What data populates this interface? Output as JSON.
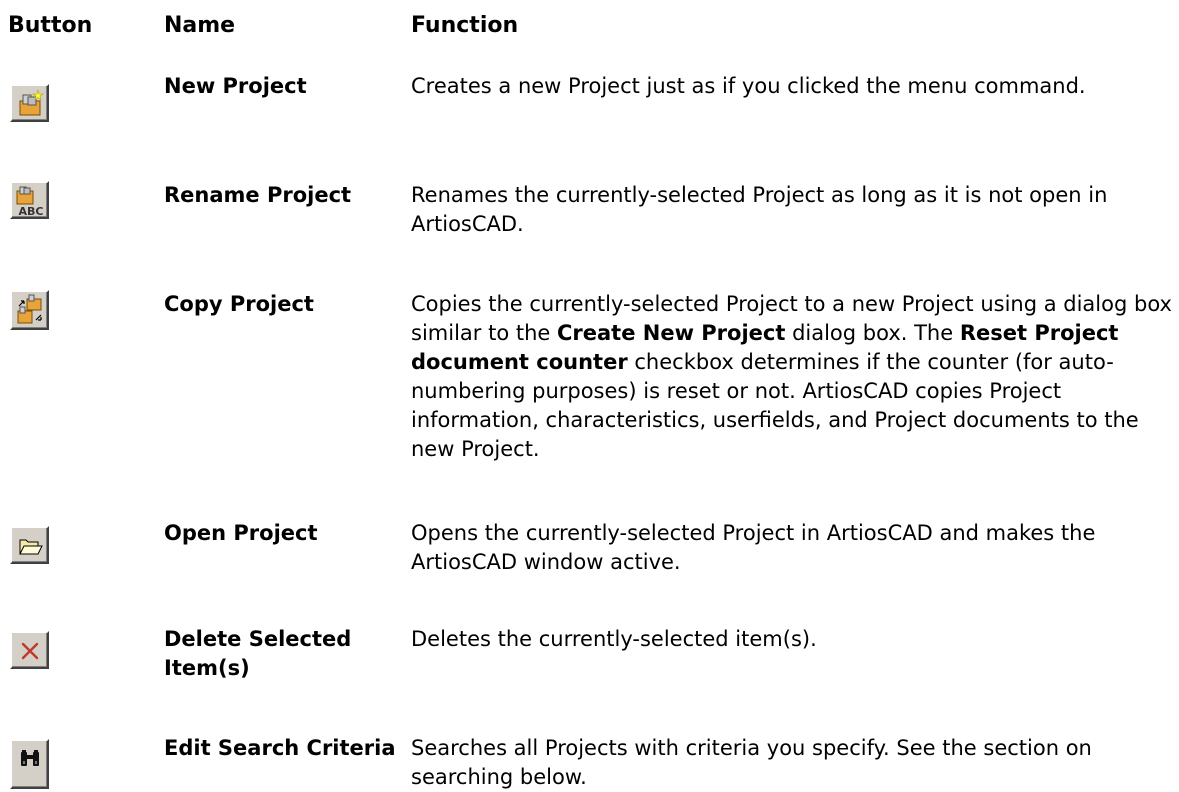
{
  "header": {
    "button": "Button",
    "name": "Name",
    "function": "Function"
  },
  "rows": [
    {
      "icon": "new-project-icon",
      "name": "New Project",
      "function": "Creates a new Project just as if you clicked the menu command."
    },
    {
      "icon": "rename-project-icon",
      "icon_text": "ABC",
      "name": "Rename Project",
      "function": "Renames the currently-selected Project as long as it is not open in ArtiosCAD."
    },
    {
      "icon": "copy-project-icon",
      "name": "Copy Project",
      "function_parts": {
        "p1": "Copies the currently-selected Project to a new Project using a dialog box similar to the ",
        "b1": "Create New Project",
        "p2": " dialog box. The ",
        "b2": "Reset Project document counter",
        "p3": " checkbox determines if the counter (for auto-numbering purposes) is reset or not. ArtiosCAD copies Project information, characteristics, userfields, and Project documents to the new Project."
      }
    },
    {
      "icon": "open-project-icon",
      "name": "Open Project",
      "function": "Opens the currently-selected Project in ArtiosCAD and makes the ArtiosCAD window active."
    },
    {
      "icon": "delete-icon",
      "name": "Delete Selected Item(s)",
      "function": "Deletes the currently-selected item(s)."
    },
    {
      "icon": "binoculars-icon",
      "name": "Edit Search Criteria",
      "function": "Searches all Projects with criteria you specify. See the section on searching below."
    }
  ],
  "colors": {
    "button_face": "#d4d0c8",
    "folder": "#e8a33a",
    "delete_x": "#c0392b"
  }
}
